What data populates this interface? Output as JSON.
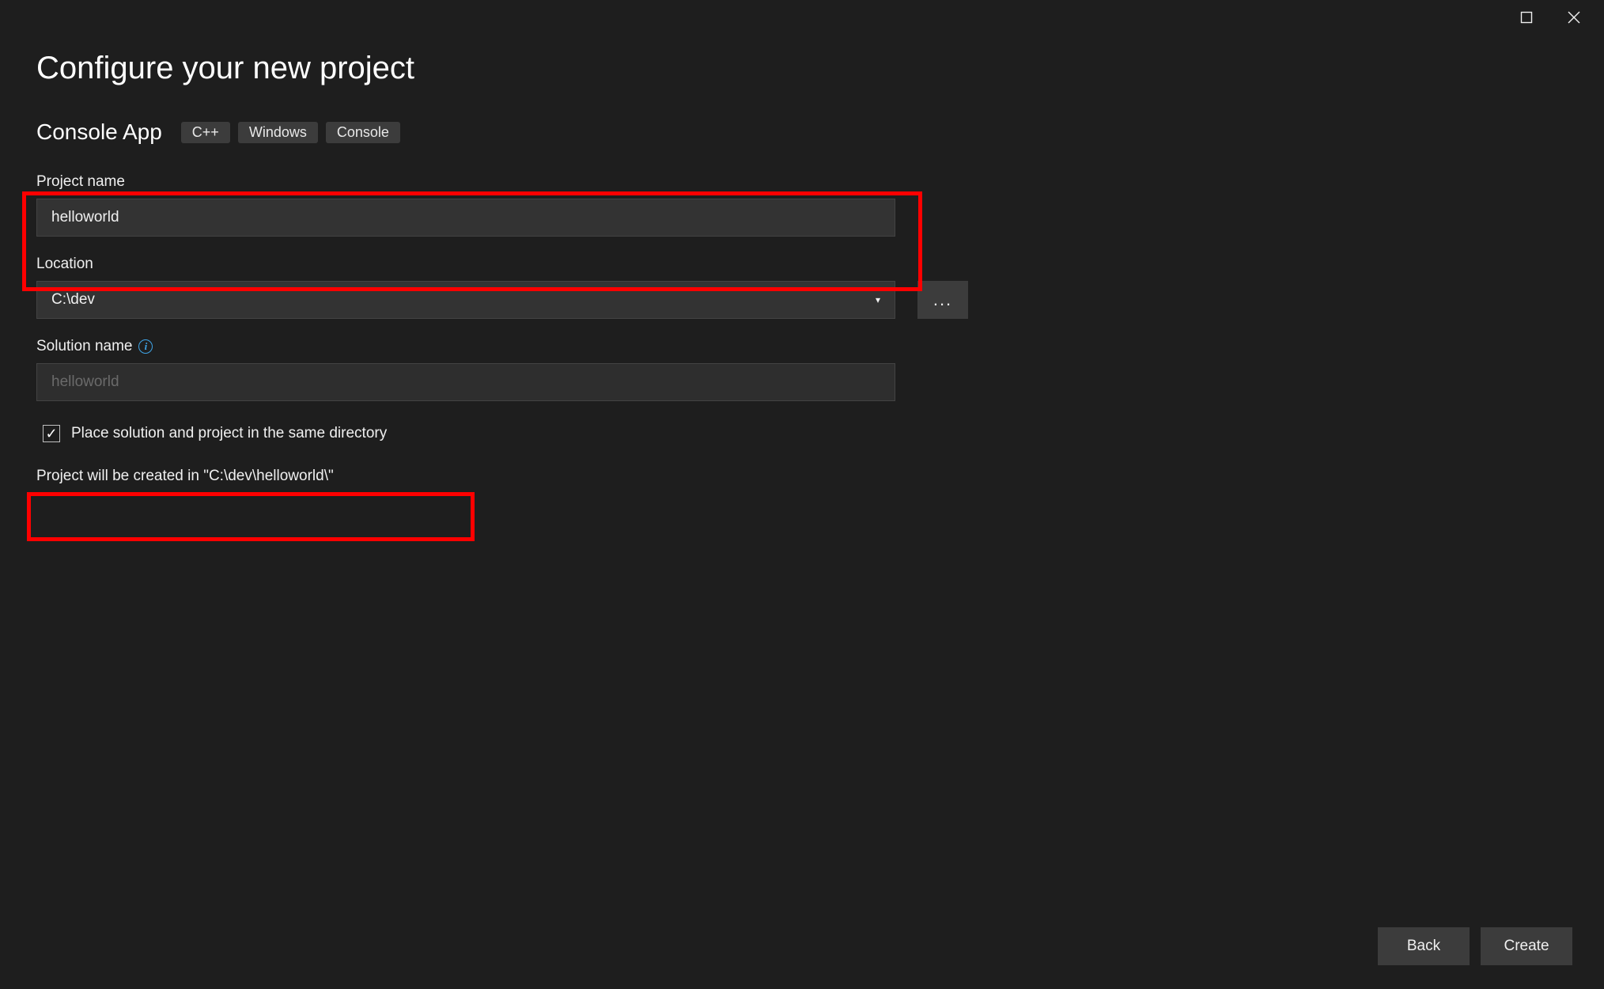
{
  "title": "Configure your new project",
  "template": {
    "name": "Console App",
    "tags": [
      "C++",
      "Windows",
      "Console"
    ]
  },
  "fields": {
    "project_name": {
      "label": "Project name",
      "value": "helloworld"
    },
    "location": {
      "label": "Location",
      "value": "C:\\dev",
      "browse_label": "..."
    },
    "solution_name": {
      "label": "Solution name",
      "placeholder": "helloworld"
    },
    "same_directory": {
      "label": "Place solution and project in the same directory",
      "checked": true
    }
  },
  "hint": "Project will be created in \"C:\\dev\\helloworld\\\"",
  "footer": {
    "back": "Back",
    "create": "Create"
  },
  "info_icon_char": "i",
  "combo_arrow": "▾"
}
